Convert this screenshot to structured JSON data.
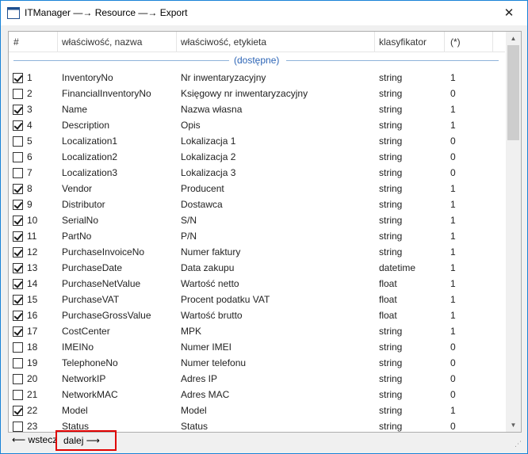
{
  "window": {
    "title": "ITManager —→ Resource —→ Export",
    "close_glyph": "✕"
  },
  "table": {
    "columns": [
      "#",
      "właściwość, nazwa",
      "właściwość, etykieta",
      "klasyfikator",
      "(*)"
    ],
    "group_label": "(dostępne)",
    "rows": [
      {
        "checked": true,
        "num": "1",
        "name": "InventoryNo",
        "label": "Nr inwentaryzacyjny",
        "type": "string",
        "flag": "1"
      },
      {
        "checked": false,
        "num": "2",
        "name": "FinancialInventoryNo",
        "label": "Księgowy nr inwentaryzacyjny",
        "type": "string",
        "flag": "0"
      },
      {
        "checked": true,
        "num": "3",
        "name": "Name",
        "label": "Nazwa własna",
        "type": "string",
        "flag": "1"
      },
      {
        "checked": true,
        "num": "4",
        "name": "Description",
        "label": "Opis",
        "type": "string",
        "flag": "1"
      },
      {
        "checked": false,
        "num": "5",
        "name": "Localization1",
        "label": "Lokalizacja 1",
        "type": "string",
        "flag": "0"
      },
      {
        "checked": false,
        "num": "6",
        "name": "Localization2",
        "label": "Lokalizacja 2",
        "type": "string",
        "flag": "0"
      },
      {
        "checked": false,
        "num": "7",
        "name": "Localization3",
        "label": "Lokalizacja 3",
        "type": "string",
        "flag": "0"
      },
      {
        "checked": true,
        "num": "8",
        "name": "Vendor",
        "label": "Producent",
        "type": "string",
        "flag": "1"
      },
      {
        "checked": true,
        "num": "9",
        "name": "Distributor",
        "label": "Dostawca",
        "type": "string",
        "flag": "1"
      },
      {
        "checked": true,
        "num": "10",
        "name": "SerialNo",
        "label": "S/N",
        "type": "string",
        "flag": "1"
      },
      {
        "checked": true,
        "num": "11",
        "name": "PartNo",
        "label": "P/N",
        "type": "string",
        "flag": "1"
      },
      {
        "checked": true,
        "num": "12",
        "name": "PurchaseInvoiceNo",
        "label": "Numer faktury",
        "type": "string",
        "flag": "1"
      },
      {
        "checked": true,
        "num": "13",
        "name": "PurchaseDate",
        "label": "Data zakupu",
        "type": "datetime",
        "flag": "1"
      },
      {
        "checked": true,
        "num": "14",
        "name": "PurchaseNetValue",
        "label": "Wartość netto",
        "type": "float",
        "flag": "1"
      },
      {
        "checked": true,
        "num": "15",
        "name": "PurchaseVAT",
        "label": "Procent podatku VAT",
        "type": "float",
        "flag": "1"
      },
      {
        "checked": true,
        "num": "16",
        "name": "PurchaseGrossValue",
        "label": "Wartość brutto",
        "type": "float",
        "flag": "1"
      },
      {
        "checked": true,
        "num": "17",
        "name": "CostCenter",
        "label": "MPK",
        "type": "string",
        "flag": "1"
      },
      {
        "checked": false,
        "num": "18",
        "name": "IMEINo",
        "label": "Numer IMEI",
        "type": "string",
        "flag": "0"
      },
      {
        "checked": false,
        "num": "19",
        "name": "TelephoneNo",
        "label": "Numer telefonu",
        "type": "string",
        "flag": "0"
      },
      {
        "checked": false,
        "num": "20",
        "name": "NetworkIP",
        "label": "Adres IP",
        "type": "string",
        "flag": "0"
      },
      {
        "checked": false,
        "num": "21",
        "name": "NetworkMAC",
        "label": "Adres MAC",
        "type": "string",
        "flag": "0"
      },
      {
        "checked": true,
        "num": "22",
        "name": "Model",
        "label": "Model",
        "type": "string",
        "flag": "1"
      },
      {
        "checked": false,
        "num": "23",
        "name": "Status",
        "label": "Status",
        "type": "string",
        "flag": "0"
      }
    ]
  },
  "footer": {
    "back_label": "⟵ wstecz",
    "next_label": "dalej ⟶"
  },
  "colors": {
    "window_border": "#1883d7",
    "group_label": "#2d65b6",
    "highlight_border": "#e00000"
  }
}
